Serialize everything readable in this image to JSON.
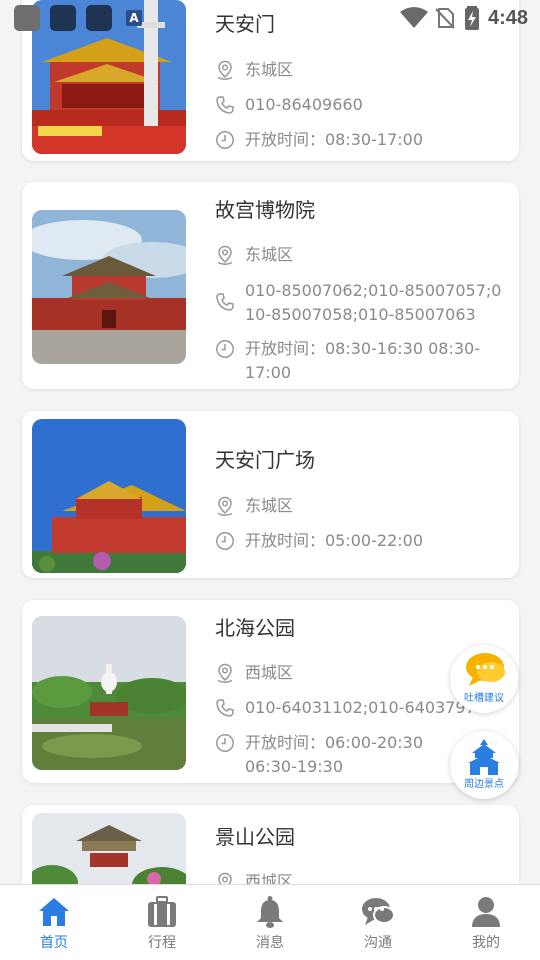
{
  "status_bar": {
    "time": "4:48",
    "notif_badge": "A"
  },
  "attractions": [
    {
      "name": "天安门",
      "district": "东城区",
      "phone": "010-86409660",
      "hours": "开放时间：08:30-17:00"
    },
    {
      "name": "故宫博物院",
      "district": "东城区",
      "phone": "010-85007062;010-85007057;010-85007058;010-85007063",
      "hours": "开放时间：08:30-16:30 08:30-17:00"
    },
    {
      "name": "天安门广场",
      "district": "东城区",
      "hours": "开放时间：05:00-22:00"
    },
    {
      "name": "北海公园",
      "district": "西城区",
      "phone": "010-64031102;010-64037972",
      "hours": "开放时间：06:00-20:30 06:30-19:30"
    },
    {
      "name": "景山公园",
      "district": "西城区"
    }
  ],
  "floating": {
    "feedback_label": "吐槽建议",
    "nearby_label": "周边景点"
  },
  "tabbar": {
    "items": [
      {
        "label": "首页",
        "icon": "home-icon",
        "active": true
      },
      {
        "label": "行程",
        "icon": "luggage-icon",
        "active": false
      },
      {
        "label": "消息",
        "icon": "bell-icon",
        "active": false
      },
      {
        "label": "沟通",
        "icon": "chat-icon",
        "active": false
      },
      {
        "label": "我的",
        "icon": "user-icon",
        "active": false
      }
    ]
  },
  "colors": {
    "accent": "#2a7de1",
    "text_primary": "#333333",
    "text_secondary": "#8a8a8a",
    "background": "#f4f4f4"
  }
}
